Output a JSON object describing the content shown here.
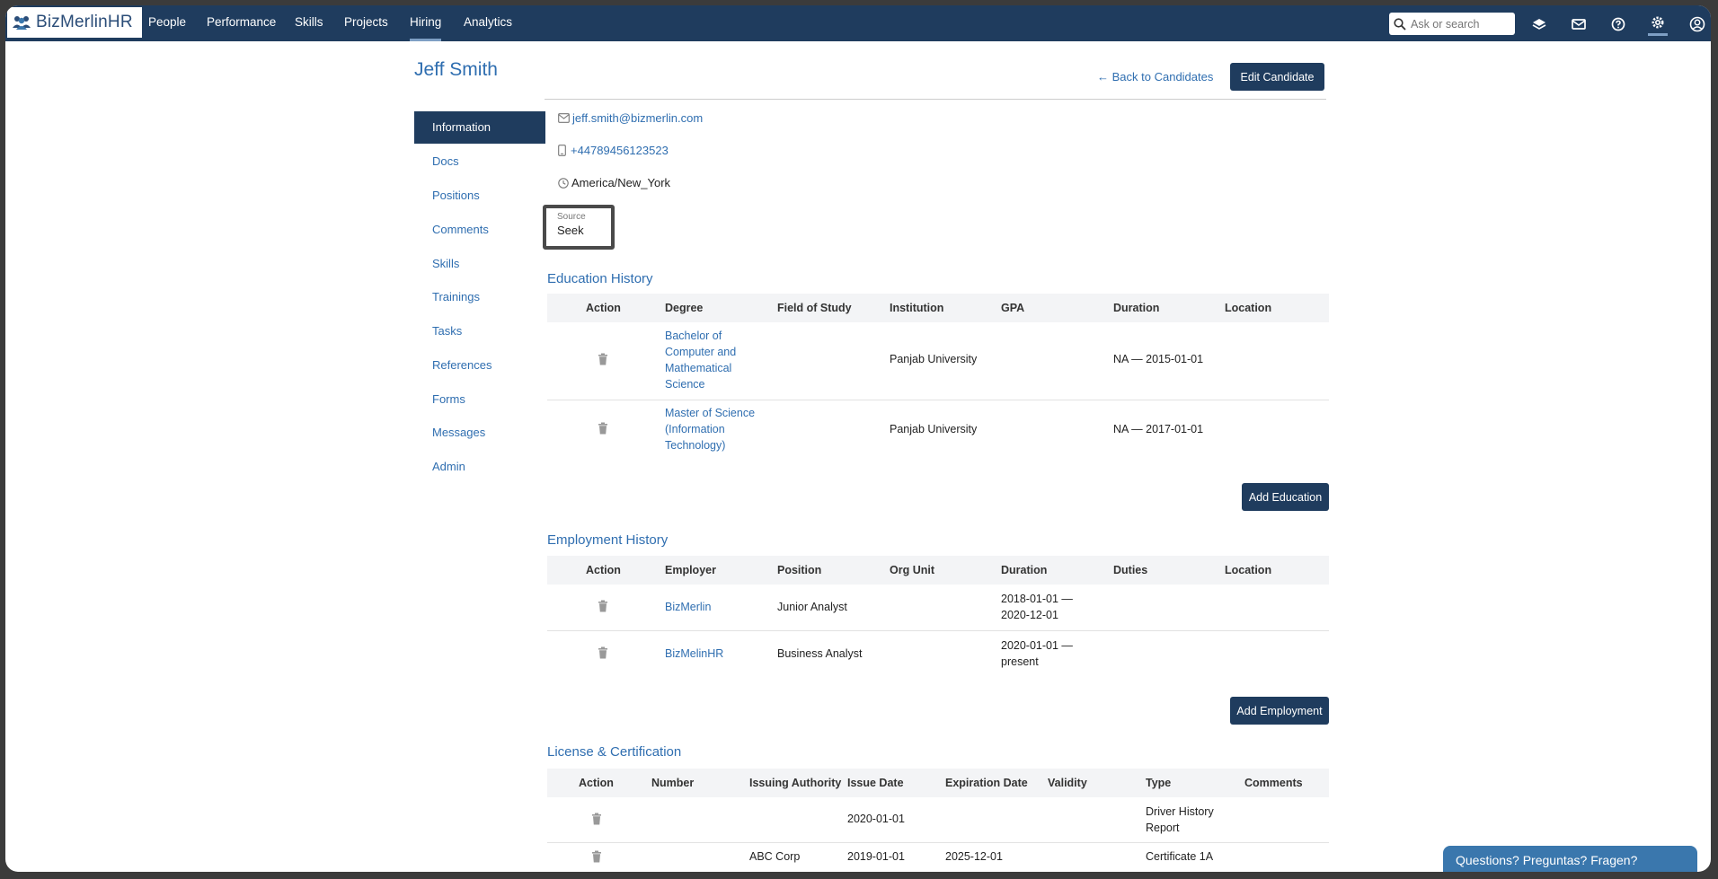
{
  "app": {
    "logo_text": "BizMerlinHR"
  },
  "nav": {
    "items": [
      "People",
      "Performance",
      "Skills",
      "Projects",
      "Hiring",
      "Analytics"
    ],
    "active": "Hiring",
    "search_placeholder": "Ask or search"
  },
  "header": {
    "name": "Jeff Smith",
    "back_label": "Back to Candidates",
    "edit_label": "Edit Candidate"
  },
  "sidebar": {
    "items": [
      "Information",
      "Docs",
      "Positions",
      "Comments",
      "Skills",
      "Trainings",
      "Tasks",
      "References",
      "Forms",
      "Messages",
      "Admin"
    ],
    "active": "Information"
  },
  "contact": {
    "email": "jeff.smith@bizmerlin.com",
    "phone": "+44789456123523",
    "timezone": "America/New_York",
    "source_label": "Source",
    "source_value": "Seek"
  },
  "education": {
    "title": "Education History",
    "columns": [
      "Action",
      "Degree",
      "Field of Study",
      "Institution",
      "GPA",
      "Duration",
      "Location"
    ],
    "rows": [
      {
        "degree": "Bachelor of Computer and Mathematical Science",
        "field": "",
        "institution": "Panjab University",
        "gpa": "",
        "duration": "NA — 2015-01-01",
        "location": ""
      },
      {
        "degree": "Master of Science (Information Technology)",
        "field": "",
        "institution": "Panjab University",
        "gpa": "",
        "duration": "NA — 2017-01-01",
        "location": ""
      }
    ],
    "add_label": "Add Education"
  },
  "employment": {
    "title": "Employment History",
    "columns": [
      "Action",
      "Employer",
      "Position",
      "Org Unit",
      "Duration",
      "Duties",
      "Location"
    ],
    "rows": [
      {
        "employer": "BizMerlin",
        "position": "Junior Analyst",
        "org_unit": "",
        "duration": "2018-01-01 — 2020-12-01",
        "duties": "",
        "location": ""
      },
      {
        "employer": "BizMelinHR",
        "position": "Business Analyst",
        "org_unit": "",
        "duration": "2020-01-01 — present",
        "duties": "",
        "location": ""
      }
    ],
    "add_label": "Add Employment"
  },
  "license": {
    "title": "License & Certification",
    "columns": [
      "Action",
      "Number",
      "Issuing Authority",
      "Issue Date",
      "Expiration Date",
      "Validity",
      "Type",
      "Comments"
    ],
    "rows": [
      {
        "number": "",
        "authority": "",
        "issue": "2020-01-01",
        "expiration": "",
        "validity": "",
        "type": "Driver History Report",
        "comments": ""
      },
      {
        "number": "",
        "authority": "ABC Corp",
        "issue": "2019-01-01",
        "expiration": "2025-12-01",
        "validity": "",
        "type": "Certificate 1A",
        "comments": ""
      }
    ]
  },
  "help": {
    "label": "Questions? Preguntas? Fragen?"
  },
  "icons": {
    "nav": [
      "search-icon",
      "layers-icon",
      "mail-icon",
      "help-icon",
      "settings-icon",
      "user-icon"
    ],
    "contact": [
      "envelope-icon",
      "phone-icon",
      "clock-icon"
    ],
    "row_action": "trash-icon"
  },
  "colors": {
    "navy": "#1f3c5e",
    "link": "#2f6eb0",
    "help": "#3a77ad"
  }
}
